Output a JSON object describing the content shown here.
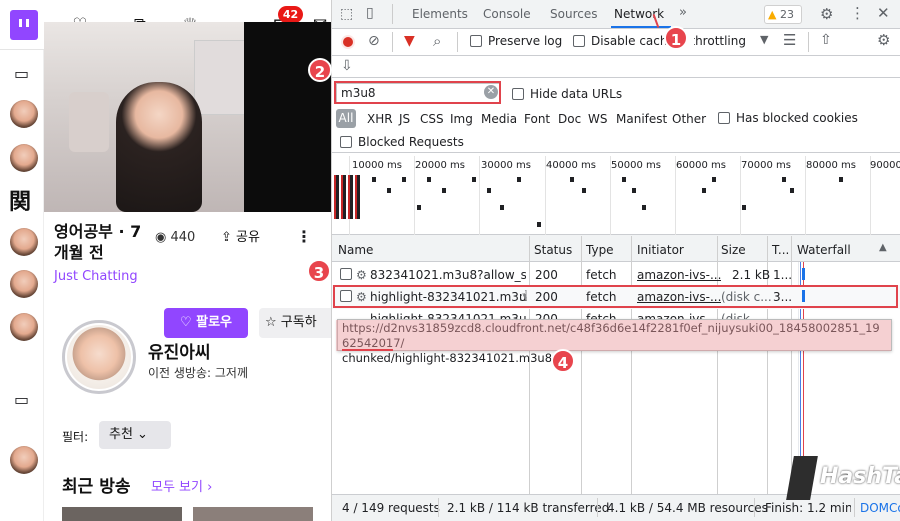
{
  "twitch": {
    "notif_count": "42",
    "stream_title": "영어공부 · 7개월 전",
    "views": "440",
    "share_label": "공유",
    "category": "Just Chatting",
    "follow_label": "팔로우",
    "subscribe_label": "구독하",
    "channel_name": "유진아씨",
    "last_stream": "이전 생방송: 그저께",
    "filter_label": "필터:",
    "filter_value": "추천",
    "recent_title": "최근 방송",
    "see_all": "모두 보기 ›",
    "sidebar_glyph": "関"
  },
  "devtools": {
    "tabs": [
      "Elements",
      "Console",
      "Sources",
      "Network"
    ],
    "warnings": "23",
    "preserve_log": "Preserve log",
    "disable_cache": "Disable cache",
    "throttling": "No throttling",
    "filter_value": "m3u8",
    "hide_data_urls": "Hide data URLs",
    "types": [
      "All",
      "XHR",
      "JS",
      "CSS",
      "Img",
      "Media",
      "Font",
      "Doc",
      "WS",
      "Manifest",
      "Other"
    ],
    "has_blocked_cookies": "Has blocked cookies",
    "blocked_requests": "Blocked Requests",
    "ticks": [
      "10000 ms",
      "20000 ms",
      "30000 ms",
      "40000 ms",
      "50000 ms",
      "60000 ms",
      "70000 ms",
      "80000 ms",
      "90000"
    ],
    "columns": [
      "Name",
      "Status",
      "Type",
      "Initiator",
      "Size",
      "T...",
      "Waterfall"
    ],
    "rows": [
      {
        "name": "832341021.m3u8?allow_sou...",
        "status": "200",
        "type": "fetch",
        "initiator": "amazon-ivs-...",
        "size": "2.1 kB",
        "time": "1..."
      },
      {
        "name": "highlight-832341021.m3u8",
        "status": "200",
        "type": "fetch",
        "initiator": "amazon-ivs-...",
        "size": "(disk c...",
        "time": "3..."
      },
      {
        "name": "highlight-832341021.m3u8",
        "status": "200",
        "type": "fetch",
        "initiator": "amazon-ivs-...",
        "size": "(disk",
        "time": "..."
      }
    ],
    "tooltip_line1": "https://d2nvs31859zcd8.cloudfront.net/c48f36d6e14f2281f0ef_nijuysuki00_18458002851_1962542017/",
    "tooltip_line2": "chunked/highlight-832341021.m3u8",
    "status": {
      "requests": "4 / 149 requests",
      "transferred": "2.1 kB / 114 kB transferred",
      "resources": "4.1 kB / 54.4 MB resources",
      "finish": "Finish: 1.2 min",
      "domc": "DOMCo"
    },
    "callouts": [
      "1",
      "2",
      "3",
      "4"
    ]
  },
  "watermark": "HashTag",
  "colors": {
    "twitch_purple": "#9146ff",
    "callout_red": "#e8454d",
    "devtools_blue": "#1a73e8"
  }
}
